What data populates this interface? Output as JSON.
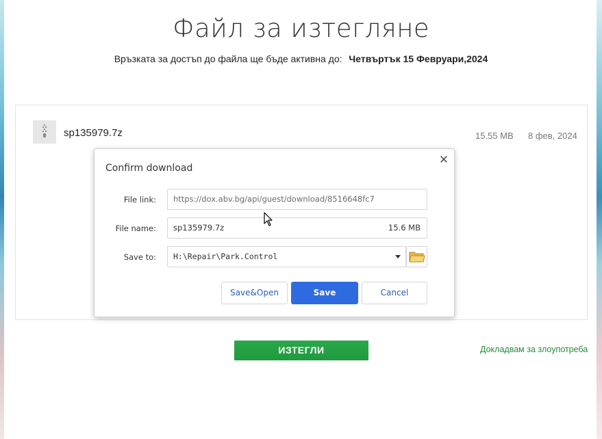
{
  "page": {
    "title": "Файл за изтегляне",
    "availability_text": "Връзката за достъп до файла ще бъде активна до:",
    "availability_date": "Четвъртък 15 Февруари,2024"
  },
  "file": {
    "icon": "zip-archive-icon",
    "name": "sp135979.7z",
    "size": "15.55 MB",
    "date": "8 фев, 2024"
  },
  "dialog": {
    "title": "Confirm download",
    "close_icon": "close-icon",
    "file_link_label": "File link:",
    "file_link_value": "https://dox.abv.bg/api/guest/download/8516648fc7",
    "file_name_label": "File name:",
    "file_name_value": "sp135979.7z",
    "file_name_size": "15.6 MB",
    "save_to_label": "Save to:",
    "save_to_value": "H:\\Repair\\Park.Control",
    "folder_icon": "folder-icon",
    "buttons": {
      "save_open": "Save&Open",
      "save": "Save",
      "cancel": "Cancel"
    }
  },
  "actions": {
    "download_label": "ИЗТЕГЛИ",
    "report_label": "Докладвам за злоупотреба"
  },
  "colors": {
    "primary_button": "#2f6be0",
    "download_button": "#1f9a3e",
    "report_link": "#2a8a3a"
  }
}
